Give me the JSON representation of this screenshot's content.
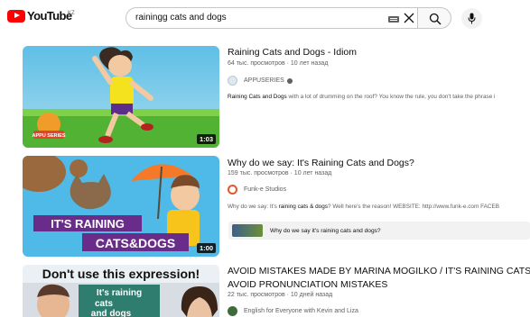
{
  "header": {
    "logo_text": "YouTube",
    "logo_country": "KZ",
    "search_value": "rainingg cats and dogs"
  },
  "results": [
    {
      "title": "Raining Cats and Dogs - Idiom",
      "meta": "64 тыс. просмотров · 10 лет назад",
      "channel": "APPUSERIES",
      "snippet_bold": "Raining Cats and Dogs",
      "snippet_rest": " with a lot of drumming on the roof? You know the rule, you don't take the phrase i",
      "duration": "1:03",
      "thumb_badge": "APPU SERIES"
    },
    {
      "title": "Why do we say: It's Raining Cats and Dogs?",
      "meta": "159 тыс. просмотров · 10 лет назад",
      "channel": "Funk-e Studios",
      "snippet_pre": "Why do we say: It's ",
      "snippet_bold": "raining cats & dogs",
      "snippet_rest": "? Well here's the reason! WEBSITE: http://www.funk-e.com FACEB",
      "chapter": "Why do we say it's raining cats and dogs?",
      "duration": "1:00",
      "thumb_line1": "IT'S RAINING",
      "thumb_line2": "CATS&DOGS"
    },
    {
      "title_line1": "AVOID MISTAKES MADE BY MARINA MOGILKO / IT'S RAINING CATS A",
      "title_line2": "AVOID PRONUNCIATION MISTAKES",
      "meta": "22 тыс. просмотров · 10 дней назад",
      "channel": "English for Everyone with Kevin and Liza",
      "thumb_banner": "Don't use this expression!",
      "thumb_sign1": "It's raining",
      "thumb_sign2": "cats",
      "thumb_sign3": "and dogs"
    }
  ],
  "colors": {
    "brand_red": "#ff0000",
    "text_primary": "#0f0f0f",
    "text_secondary": "#606060"
  }
}
